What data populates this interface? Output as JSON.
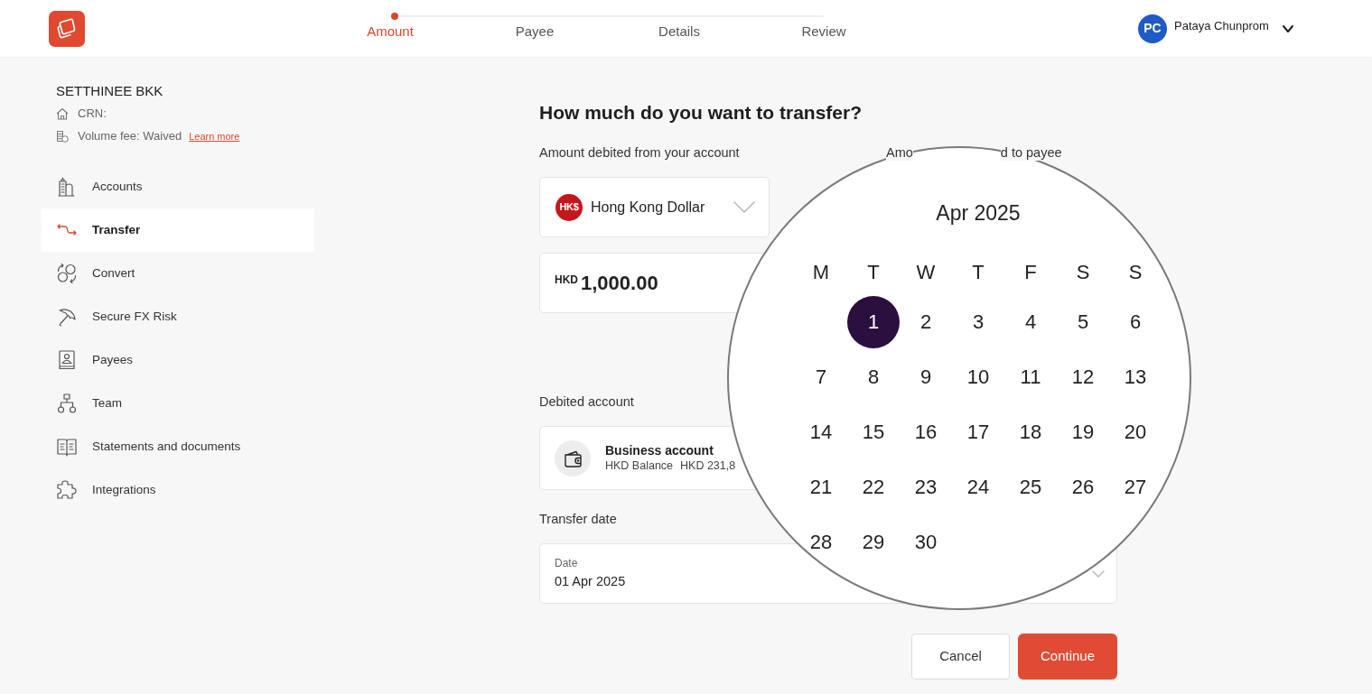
{
  "header": {
    "steps": [
      {
        "label": "Amount",
        "selected": true
      },
      {
        "label": "Payee",
        "selected": false
      },
      {
        "label": "Details",
        "selected": false
      },
      {
        "label": "Review",
        "selected": false
      }
    ],
    "user": {
      "initials": "PC",
      "name": "Pataya Chunprom"
    }
  },
  "sidebar": {
    "company": "SETTHINEE BKK",
    "crn_label": "CRN:",
    "fee": "Volume fee: Waived",
    "fee_link": "Learn more",
    "items": [
      {
        "label": "Accounts",
        "selected": false
      },
      {
        "label": "Transfer",
        "selected": true
      },
      {
        "label": "Convert",
        "selected": false
      },
      {
        "label": "Secure FX Risk",
        "selected": false
      },
      {
        "label": "Payees",
        "selected": false
      },
      {
        "label": "Team",
        "selected": false
      },
      {
        "label": "Statements and documents",
        "selected": false
      },
      {
        "label": "Integrations",
        "selected": false
      }
    ]
  },
  "form": {
    "title": "How much do you want to transfer?",
    "debit_label": "Amount debited from your account",
    "credit_label_fragments": [
      "Amo",
      "d to payee"
    ],
    "currency": {
      "badge": "HK$",
      "name": "Hong Kong Dollar"
    },
    "amount": {
      "currency": "HKD",
      "value": "1,000.00"
    },
    "account_label": "Debited account",
    "account": {
      "name": "Business account",
      "balance_label": "HKD Balance",
      "balance": "HKD 231,8"
    },
    "date_label": "Transfer date",
    "date": {
      "label": "Date",
      "value": "01 Apr 2025"
    },
    "buttons": [
      {
        "label": "Cancel",
        "kind": "secondary"
      },
      {
        "label": "Continue",
        "kind": "primary"
      }
    ]
  },
  "calendar": {
    "month": "Apr 2025",
    "weekdays": [
      "M",
      "T",
      "W",
      "T",
      "F",
      "S",
      "S"
    ],
    "weeks": [
      [
        {
          "label": "1",
          "selected": true
        },
        {
          "label": "2",
          "selected": false
        },
        {
          "label": "3",
          "selected": false
        },
        {
          "label": "4",
          "selected": false
        },
        {
          "label": "5",
          "selected": false
        },
        {
          "label": "6",
          "selected": false
        }
      ],
      [
        {
          "label": "7",
          "selected": false
        },
        {
          "label": "8",
          "selected": false
        },
        {
          "label": "9",
          "selected": false
        },
        {
          "label": "10",
          "selected": false
        },
        {
          "label": "11",
          "selected": false
        },
        {
          "label": "12",
          "selected": false
        },
        {
          "label": "13",
          "selected": false
        }
      ],
      [
        {
          "label": "14",
          "selected": false
        },
        {
          "label": "15",
          "selected": false
        },
        {
          "label": "16",
          "selected": false
        },
        {
          "label": "17",
          "selected": false
        },
        {
          "label": "18",
          "selected": false
        },
        {
          "label": "19",
          "selected": false
        },
        {
          "label": "20",
          "selected": false
        }
      ],
      [
        {
          "label": "21",
          "selected": false
        },
        {
          "label": "22",
          "selected": false
        },
        {
          "label": "23",
          "selected": false
        },
        {
          "label": "24",
          "selected": false
        },
        {
          "label": "25",
          "selected": false
        },
        {
          "label": "26",
          "selected": false
        },
        {
          "label": "27",
          "selected": false
        }
      ],
      [
        {
          "label": "28",
          "selected": false
        },
        {
          "label": "29",
          "selected": false
        },
        {
          "label": "30",
          "selected": false
        }
      ]
    ]
  }
}
